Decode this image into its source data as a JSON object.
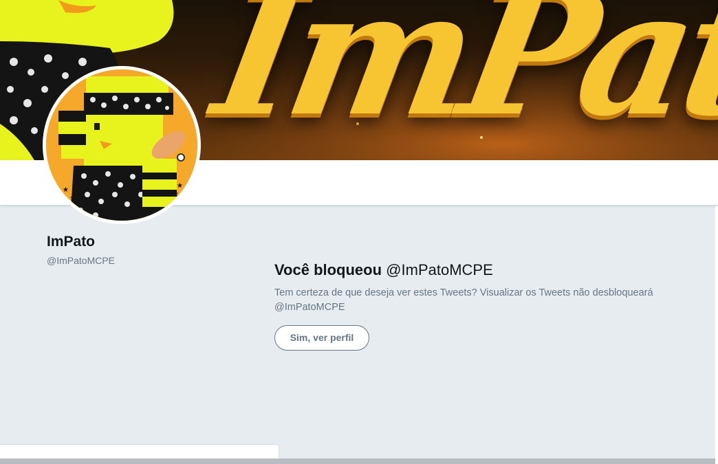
{
  "banner": {
    "title_text": "ImPato",
    "accent_color": "#f8c532"
  },
  "profile": {
    "display_name": "ImPato",
    "screen_name": "@ImPatoMCPE",
    "avatar_icon": "duck-character-avatar"
  },
  "block_notice": {
    "title_strong": "Você bloqueou",
    "title_handle": "@ImPatoMCPE",
    "description": "Tem certeza de que deseja ver estes Tweets? Visualizar os Tweets não desbloqueará @ImPatoMCPE",
    "view_button_label": "Sim, ver perfil"
  },
  "colors": {
    "background": "#e6ecf0",
    "text_primary": "#14171a",
    "text_secondary": "#657786"
  }
}
